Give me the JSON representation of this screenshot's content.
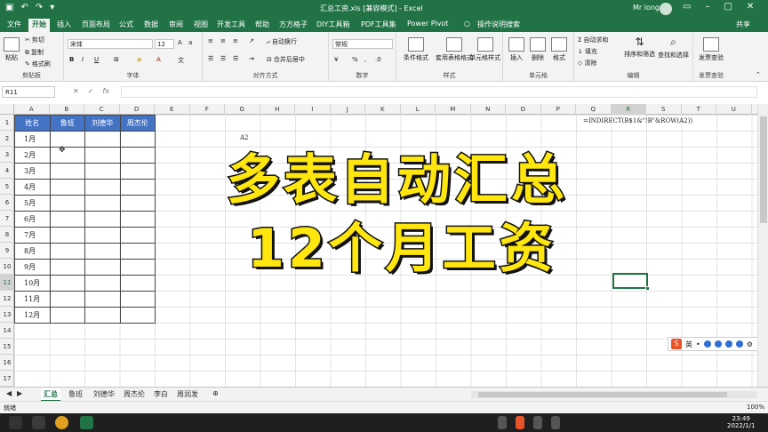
{
  "window": {
    "title": "汇总工资.xls [兼容模式] - Excel",
    "user": "Mr long"
  },
  "tabs": [
    "文件",
    "开始",
    "插入",
    "页面布局",
    "公式",
    "数据",
    "审阅",
    "视图",
    "开发工具",
    "帮助",
    "方方格子",
    "DIY工具箱",
    "PDF工具集",
    "Power Pivot",
    "操作说明搜索"
  ],
  "share": "共享",
  "ribbon": {
    "clipboard": {
      "cut": "剪切",
      "copy": "复制",
      "paste_format": "格式刷",
      "paste": "粘贴",
      "label": "剪贴板"
    },
    "font": {
      "name": "宋体",
      "size": "12",
      "label": "字体"
    },
    "align": {
      "wrap": "自动换行",
      "merge": "合并后居中",
      "label": "对齐方式"
    },
    "number": {
      "format": "常规",
      "label": "数字"
    },
    "styles": {
      "cond": "条件格式",
      "table": "套用表格格式",
      "cell": "单元格样式",
      "label": "样式"
    },
    "cells": {
      "insert": "插入",
      "delete": "删除",
      "format": "格式",
      "label": "单元格"
    },
    "edit": {
      "autosum": "自动求和",
      "fill": "填充",
      "clear": "清除",
      "sort": "排序和筛选",
      "find": "查找和选择",
      "label": "编辑"
    },
    "invoice": {
      "check": "发票查验",
      "label": "发票查验"
    }
  },
  "namebox": "R11",
  "columns": [
    "A",
    "B",
    "C",
    "D",
    "E",
    "F",
    "G",
    "H",
    "I",
    "J",
    "K",
    "L",
    "M",
    "N",
    "O",
    "P",
    "Q",
    "R",
    "S",
    "T",
    "U"
  ],
  "rows": [
    "1",
    "2",
    "3",
    "4",
    "5",
    "6",
    "7",
    "8",
    "9",
    "10",
    "11",
    "12",
    "13",
    "14",
    "15",
    "16",
    "17"
  ],
  "table": {
    "headers": [
      "姓名",
      "鲁班",
      "刘德华",
      "周杰伦"
    ],
    "months": [
      "1月",
      "2月",
      "3月",
      "4月",
      "5月",
      "6月",
      "7月",
      "8月",
      "9月",
      "10月",
      "11月",
      "12月"
    ]
  },
  "cells": {
    "g2": "A2",
    "q1": "=INDIRECT(B$1&\"!B\"&ROW(A2))"
  },
  "overlay": {
    "line1": "多表自动汇总",
    "line2": "12个月工资"
  },
  "ime": {
    "lang": "英"
  },
  "sheets": [
    "汇总",
    "鲁班",
    "刘德华",
    "周杰伦",
    "李白",
    "周润发"
  ],
  "status": {
    "ready": "就绪",
    "zoom": "100%"
  },
  "clock": {
    "time": "23:49",
    "date": "2022/1/1"
  },
  "colors": {
    "excel_green": "#217346",
    "header_blue": "#4472c4",
    "overlay_yellow": "#ffe60f"
  }
}
